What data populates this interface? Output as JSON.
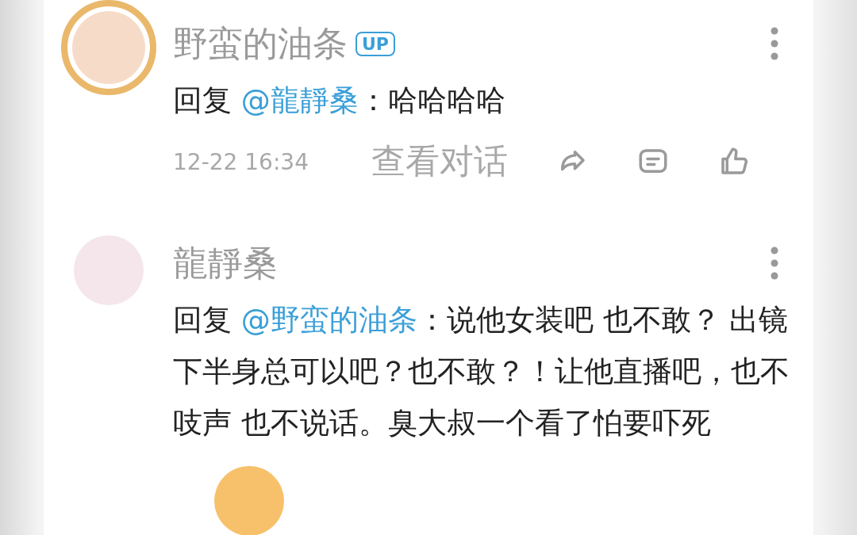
{
  "comments": [
    {
      "name": "野蛮的油条",
      "badge": "UP",
      "reply_label": "回复",
      "mention": "@龍靜桑",
      "text": "：哈哈哈哈",
      "time": "12-22 16:34",
      "view_dialog": "查看对话",
      "avatar_frame": true
    },
    {
      "name": "龍靜桑",
      "reply_label": "回复",
      "mention": "@野蛮的油条",
      "text": "：说他女装吧 也不敢？ 出镜下半身总可以吧？也不敢？！让他直播吧，也不吱声 也不说话。臭大叔一个看了怕要吓死",
      "avatar_frame": false
    },
    {
      "avatar_frame": false
    }
  ]
}
